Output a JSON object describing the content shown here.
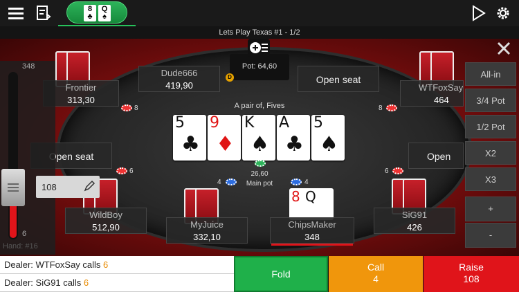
{
  "table": {
    "title": "Lets Play Texas #1 - 1/2",
    "tab_cards": [
      "8",
      "Q"
    ]
  },
  "pot": {
    "label": "Pot: 64,60",
    "main_amount": "26,60",
    "main_label": "Main pot"
  },
  "hand_description": "A pair of, Fives",
  "community_cards": [
    {
      "rank": "5",
      "suit": "♣",
      "color": "black"
    },
    {
      "rank": "9",
      "suit": "♦",
      "color": "red"
    },
    {
      "rank": "K",
      "suit": "♠",
      "color": "black"
    },
    {
      "rank": "A",
      "suit": "♣",
      "color": "black"
    },
    {
      "rank": "5",
      "suit": "♠",
      "color": "black"
    }
  ],
  "players": {
    "frontier": {
      "name": "Frontier",
      "stack": "313,30",
      "bet": "8"
    },
    "dude666": {
      "name": "Dude666",
      "stack": "419,90"
    },
    "wtfoxsay": {
      "name": "WTFoxSay",
      "stack": "464",
      "bet": "8"
    },
    "wildboy": {
      "name": "WildBoy",
      "stack": "512,90",
      "bet": "6"
    },
    "myjuice": {
      "name": "MyJuice",
      "stack": "332,10",
      "bet": "4"
    },
    "chipsmaker": {
      "name": "ChipsMaker",
      "stack": "348",
      "bet": "4",
      "hole_cards": [
        "8",
        "Q"
      ]
    },
    "sig91": {
      "name": "SiG91",
      "stack": "426",
      "bet": "6"
    }
  },
  "open_seats": [
    "Open seat",
    "Open seat",
    "Open seat",
    "Open seat"
  ],
  "dealer_button": "D",
  "slider": {
    "max": "348",
    "min": "6",
    "value": "108",
    "hand_label": "Hand: #16"
  },
  "side_actions": [
    "All-in",
    "3/4 Pot",
    "1/2 Pot",
    "X2",
    "X3"
  ],
  "stepper": {
    "plus": "+",
    "minus": "-"
  },
  "log": [
    {
      "text": "Dealer: WTFoxSay calls ",
      "amount": "6"
    },
    {
      "text": "Dealer: SiG91 calls ",
      "amount": "6"
    }
  ],
  "actions": {
    "fold": "Fold",
    "call": "Call",
    "call_amount": "4",
    "raise": "Raise",
    "raise_amount": "108"
  },
  "colors": {
    "fold": "#1fb04a",
    "call": "#f0960c",
    "raise": "#e0141a",
    "felt": "#a11a1a"
  },
  "icons": [
    "menu-icon",
    "history-icon",
    "play-icon",
    "gear-icon",
    "close-icon",
    "add-chips-icon",
    "pencil-icon"
  ]
}
